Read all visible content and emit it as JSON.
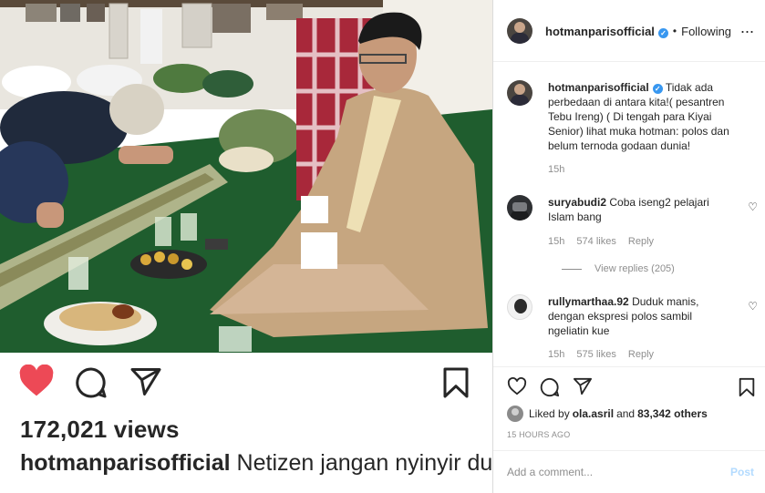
{
  "post": {
    "views": "172,021 views",
    "caption_user": "hotmanparisofficial",
    "caption_text": "Netizen jangan nyinyir dulu! Sebelum tiba jenazah Gus"
  },
  "header": {
    "username": "hotmanparisofficial",
    "verified_mark": "✓",
    "separator": "•",
    "follow_label": "Following",
    "more_label": "..."
  },
  "comments": [
    {
      "user": "hotmanparisofficial",
      "verified_mark": "✓",
      "text": "Tidak ada perbedaan di antara kita!( pesantren Tebu Ireng) ( Di tengah para Kiyai Senior) lihat muka hotman: polos dan belum ternoda godaan dunia!",
      "time": "15h"
    },
    {
      "user": "suryabudi2",
      "text": "Coba iseng2 pelajari Islam bang",
      "time": "15h",
      "likes": "574 likes",
      "reply_label": "Reply",
      "view_replies": "View replies (205)"
    },
    {
      "user": "rullymarthaa.92",
      "text": "Duduk manis, dengan ekspresi polos sambil ngeliatin kue",
      "time": "15h",
      "likes": "575 likes",
      "reply_label": "Reply"
    }
  ],
  "likes": {
    "prefix": "Liked by",
    "user": "ola.asril",
    "middle": "and",
    "count": "83,342 others"
  },
  "time_ago": "15 HOURS AGO",
  "add_comment": {
    "placeholder": "Add a comment...",
    "post_label": "Post"
  },
  "icons": {
    "heart": "heart-icon",
    "comment": "comment-icon",
    "share": "share-icon",
    "save": "bookmark-icon"
  },
  "colors": {
    "liked_heart": "#ed4956",
    "verified": "#3897f0",
    "muted_text": "#8e8e8e",
    "post_button": "#b3dbff"
  }
}
